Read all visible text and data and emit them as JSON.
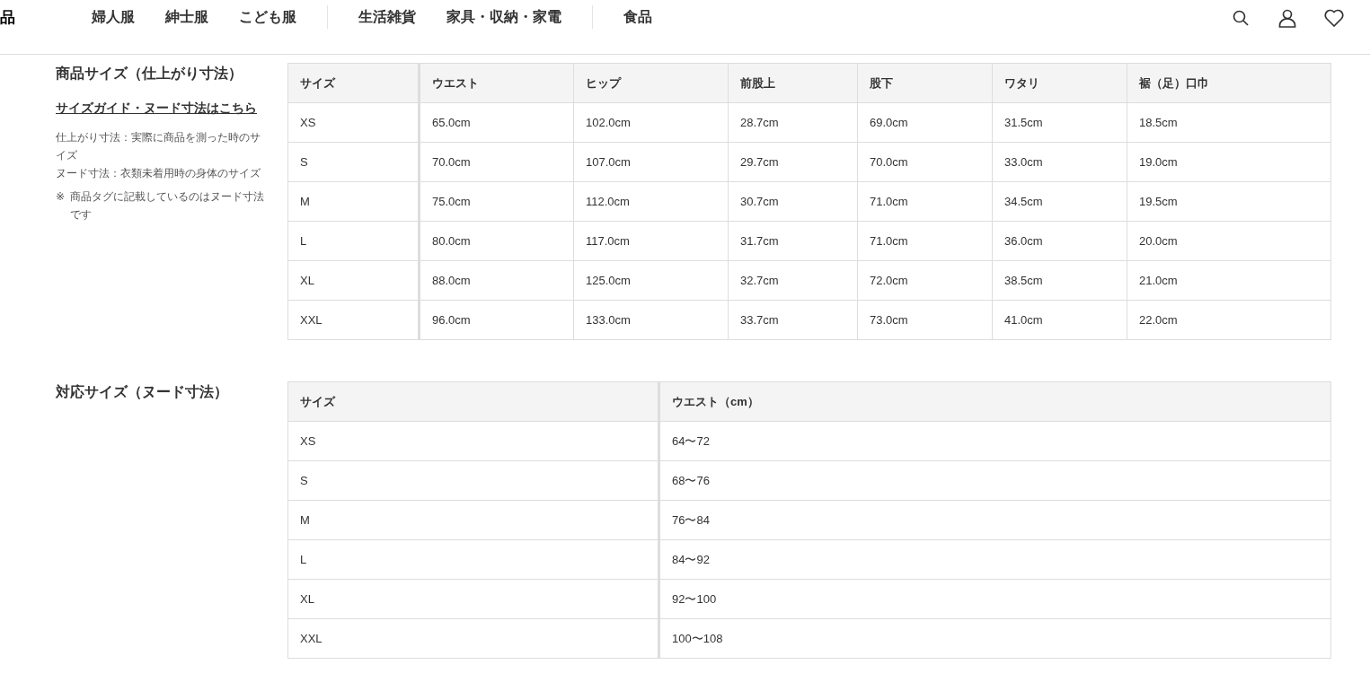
{
  "header": {
    "logo_fragment": "品",
    "nav_groups": [
      [
        "婦人服",
        "紳士服",
        "こども服"
      ],
      [
        "生活雑貨",
        "家具・収納・家電"
      ],
      [
        "食品"
      ]
    ]
  },
  "sections": [
    {
      "title": "商品サイズ（仕上がり寸法）",
      "link": "サイズガイド・ヌード寸法はこちら",
      "notes": [
        {
          "kind": "note",
          "text": "仕上がり寸法：実際に商品を測った時のサイズ"
        },
        {
          "kind": "note",
          "text": "ヌード寸法：衣類未着用時の身体のサイズ"
        },
        {
          "kind": "remark",
          "mark": "※",
          "text": "商品タグに記載しているのはヌード寸法です"
        }
      ],
      "table": {
        "columns": [
          "サイズ",
          "ウエスト",
          "ヒップ",
          "前股上",
          "股下",
          "ワタリ",
          "裾（足）口巾"
        ],
        "rows": [
          [
            "XS",
            "65.0cm",
            "102.0cm",
            "28.7cm",
            "69.0cm",
            "31.5cm",
            "18.5cm"
          ],
          [
            "S",
            "70.0cm",
            "107.0cm",
            "29.7cm",
            "70.0cm",
            "33.0cm",
            "19.0cm"
          ],
          [
            "M",
            "75.0cm",
            "112.0cm",
            "30.7cm",
            "71.0cm",
            "34.5cm",
            "19.5cm"
          ],
          [
            "L",
            "80.0cm",
            "117.0cm",
            "31.7cm",
            "71.0cm",
            "36.0cm",
            "20.0cm"
          ],
          [
            "XL",
            "88.0cm",
            "125.0cm",
            "32.7cm",
            "72.0cm",
            "38.5cm",
            "21.0cm"
          ],
          [
            "XXL",
            "96.0cm",
            "133.0cm",
            "33.7cm",
            "73.0cm",
            "41.0cm",
            "22.0cm"
          ]
        ]
      }
    },
    {
      "title": "対応サイズ（ヌード寸法）",
      "table": {
        "columns": [
          "サイズ",
          "ウエスト（cm）"
        ],
        "rows": [
          [
            "XS",
            "64〜72"
          ],
          [
            "S",
            "68〜76"
          ],
          [
            "M",
            "76〜84"
          ],
          [
            "L",
            "84〜92"
          ],
          [
            "XL",
            "92〜100"
          ],
          [
            "XXL",
            "100〜108"
          ]
        ]
      }
    }
  ]
}
